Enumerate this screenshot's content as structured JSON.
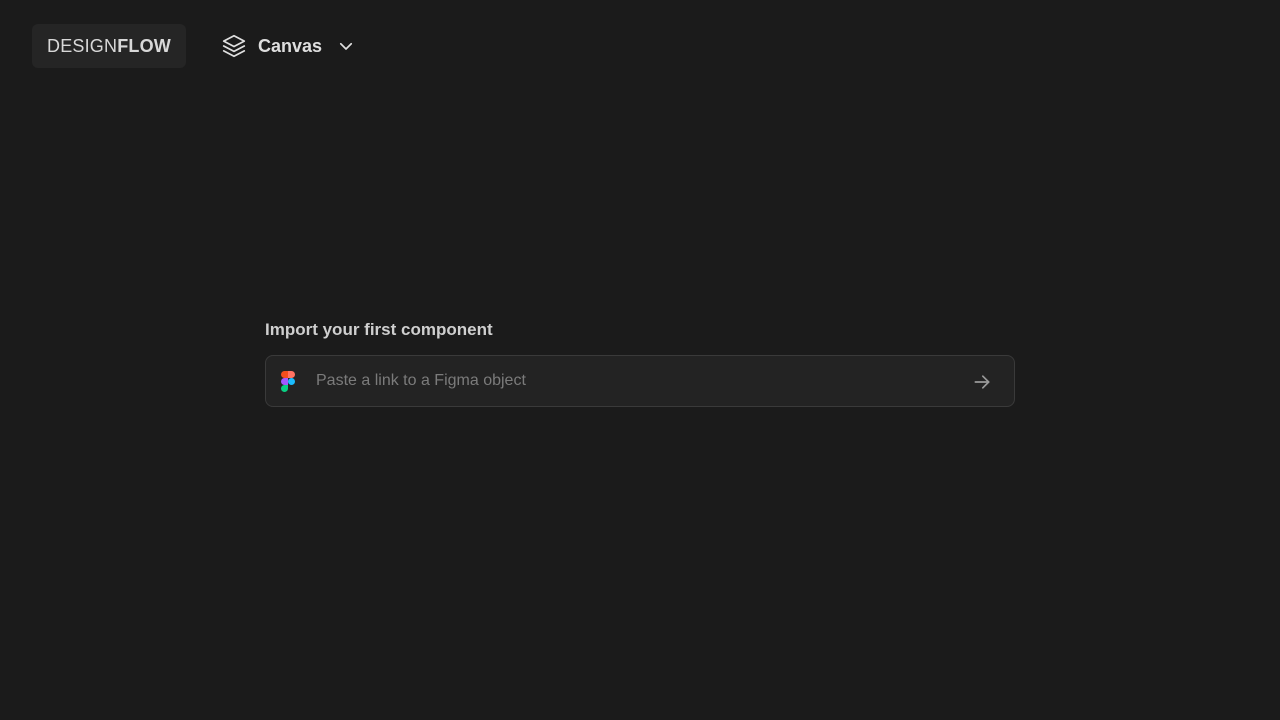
{
  "header": {
    "logo": {
      "part1": "DESIGN",
      "part2": "FLOW"
    },
    "workspace": {
      "label": "Canvas",
      "icon": "layers-icon",
      "dropdown_icon": "chevron-down-icon"
    }
  },
  "import": {
    "title": "Import your first component",
    "input": {
      "placeholder": "Paste a link to a Figma object",
      "value": "",
      "icon": "figma-icon"
    },
    "submit_icon": "arrow-right-icon"
  },
  "colors": {
    "background": "#1b1b1b",
    "surface": "#232323",
    "border": "#3a3a3a",
    "text": "#d4d4d4",
    "muted": "#7b7b7b"
  }
}
